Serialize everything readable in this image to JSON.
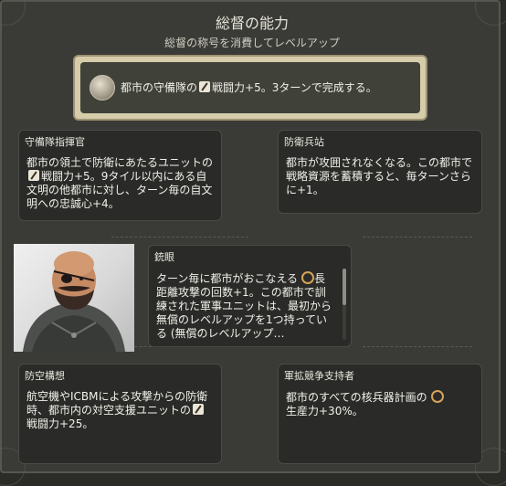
{
  "header": {
    "title": "総督の能力",
    "subtitle": "総督の称号を消費してレベルアップ"
  },
  "top_ability": {
    "icon": "medal-icon",
    "text_prefix": "都市の守備隊の",
    "text_icon": "combat-strength-icon",
    "text_suffix": "戦闘力+5。3ターンで完成する。"
  },
  "cards": {
    "garrison_commander": {
      "title": "守備隊指揮官",
      "body_part1": "都市の領土で防衛にあたるユニットの",
      "body_icon": "combat-strength-icon",
      "body_part2": "戦闘力+5。9タイル以内にある自文明の他都市に対し、ターン毎の自文明への忠誠心+4。"
    },
    "defense_logistics": {
      "title": "防衛兵站",
      "body": "都市が攻囲されなくなる。この都市で戦略資源を蓄積すると、毎ターンさらに+1。"
    },
    "bulletproof": {
      "title": "銃眼",
      "body_part1": "ターン毎に都市がおこなえる",
      "body_icon": "ranged-strike-icon",
      "body_part2": "長距離攻撃の回数+1。この都市で訓練された軍事ユニットは、最初から無償のレベルアップを1つ持っている (無償のレベルアップ…"
    },
    "air_defense": {
      "title": "防空構想",
      "body_part1": "航空機やICBMによる攻撃からの防衛時、都市内の対空支援ユニットの",
      "body_icon": "combat-strength-icon",
      "body_part2": "戦闘力+25。"
    },
    "arms_race": {
      "title": "軍拡競争支持者",
      "body_part1": "都市のすべての核兵器計画の",
      "body_icon": "production-icon",
      "body_part2": "生産力+30%。"
    }
  },
  "portrait": {
    "name": "governor-portrait"
  },
  "colors": {
    "panel": "#3a3b36",
    "card": "#2a2b28",
    "top_border": "#d5ccaa",
    "text": "#f2f0ea"
  }
}
